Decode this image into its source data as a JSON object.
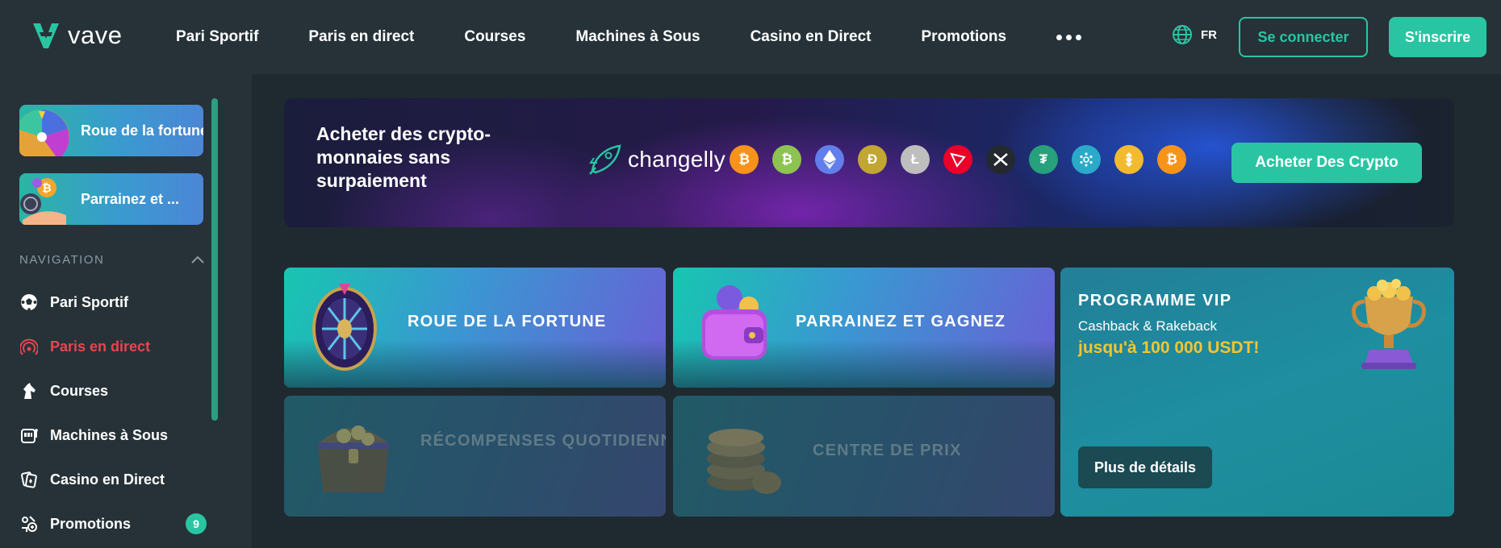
{
  "brand": {
    "name": "vave",
    "accent": "#29c5a2"
  },
  "header": {
    "nav": [
      "Pari Sportif",
      "Paris en direct",
      "Courses",
      "Machines à Sous",
      "Casino en Direct",
      "Promotions"
    ],
    "more_icon": "more-dots-icon",
    "language": "FR",
    "login_label": "Se connecter",
    "signup_label": "S'inscrire"
  },
  "sidebar": {
    "promos": [
      {
        "label": "Roue de la fortune",
        "icon": "wheel-icon"
      },
      {
        "label": "Parrainez et ...",
        "icon": "referral-coins-icon"
      }
    ],
    "section_title": "NAVIGATION",
    "items": [
      {
        "label": "Pari Sportif",
        "icon": "soccer-ball-icon"
      },
      {
        "label": "Paris en direct",
        "icon": "live-broadcast-icon",
        "color": "#e8454f"
      },
      {
        "label": "Courses",
        "icon": "horse-head-icon"
      },
      {
        "label": "Machines à Sous",
        "icon": "slot-machine-icon"
      },
      {
        "label": "Casino en Direct",
        "icon": "cards-icon"
      },
      {
        "label": "Promotions",
        "icon": "gift-icon",
        "badge": "9"
      }
    ]
  },
  "banner": {
    "title": "Acheter des crypto-monnaies sans surpaiement",
    "partner": "changelly",
    "coins": [
      "bitcoin",
      "bitcoin-cash",
      "ethereum",
      "dogecoin",
      "litecoin",
      "tron",
      "ripple",
      "tether",
      "cardano",
      "binance-coin",
      "bitcoin"
    ],
    "buy_label": "Acheter Des Crypto"
  },
  "cards": {
    "wheel": "ROUE DE LA FORTUNE",
    "referral": "PARRAINEZ ET GAGNEZ",
    "daily": "RÉCOMPENSES QUOTIDIENNES",
    "prize": "CENTRE DE PRIX"
  },
  "vip": {
    "title": "PROGRAMME VIP",
    "subtitle": "Cashback & Rakeback",
    "amount": "jusqu'à 100 000 USDT!",
    "details_label": "Plus de détails"
  }
}
